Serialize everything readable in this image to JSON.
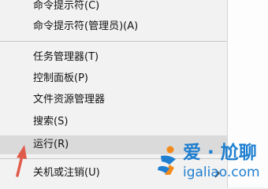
{
  "context_menu": {
    "items": [
      {
        "label": "命令提示符(C)"
      },
      {
        "label": "命令提示符(管理员)(A)"
      },
      {
        "label": "任务管理器(T)"
      },
      {
        "label": "控制面板(P)"
      },
      {
        "label": "文件资源管理器"
      },
      {
        "label": "搜索(S)"
      },
      {
        "label": "运行(R)"
      },
      {
        "label": "关机或注销(U)"
      }
    ],
    "highlighted_item": "运行(R)",
    "submenu_arrow_icon": "chevron-right-icon"
  },
  "annotation": {
    "arrow_color": "#e05a4a"
  },
  "watermark": {
    "title": "爱 · 尬聊",
    "url": "igaliao.com",
    "colors": {
      "blue": "#1f7fd0",
      "orange": "#f28a1b"
    }
  }
}
